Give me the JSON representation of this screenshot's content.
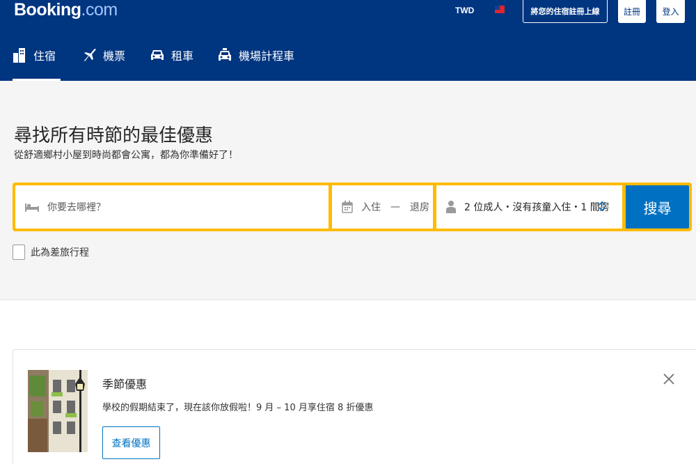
{
  "header": {
    "logo_main": "Booking",
    "logo_suffix": ".com",
    "currency": "TWD",
    "list_property": "將您的住宿註冊上線",
    "register": "註冊",
    "login": "登入"
  },
  "tabs": [
    {
      "label": "住宿",
      "icon": "bed-icon",
      "active": true
    },
    {
      "label": "機票",
      "icon": "plane-icon",
      "active": false
    },
    {
      "label": "租車",
      "icon": "car-icon",
      "active": false
    },
    {
      "label": "機場計程車",
      "icon": "taxi-icon",
      "active": false
    }
  ],
  "hero": {
    "title": "尋找所有時節的最佳優惠",
    "subtitle": "從舒適鄉村小屋到時尚都會公寓，都為你準備好了！"
  },
  "search": {
    "destination_placeholder": "你要去哪裡？",
    "checkin": "入住",
    "dash": "—",
    "checkout": "退房",
    "guests": "2 位成人・沒有孩童入住・1 間房",
    "button": "搜尋"
  },
  "business_trip": {
    "label": "此為差旅行程",
    "checked": false
  },
  "promo": {
    "title": "季節優惠",
    "text": "學校的假期結束了，現在該你放假啦！9 月 – 10 月享住宿 8 折優惠",
    "button": "查看優惠"
  },
  "colors": {
    "brand_blue": "#003580",
    "search_yellow": "#febb02",
    "action_blue": "#0071c2"
  }
}
